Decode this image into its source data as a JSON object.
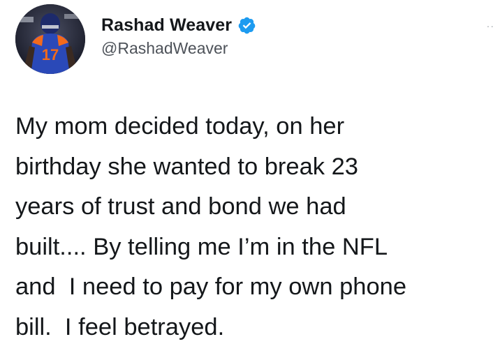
{
  "author": {
    "display_name": "Rashad Weaver",
    "handle": "@RashadWeaver",
    "verified": true,
    "verified_color": "#1d9bf0",
    "avatar_icon": "profile-photo-football-player"
  },
  "menu": {
    "icon": "more-dots-icon",
    "glyph": "··"
  },
  "tweet": {
    "lines": [
      "My mom decided today, on her",
      "birthday she wanted to break 23",
      "years of trust and bond we had",
      "built.... By telling me I’m in the NFL",
      "and  I need to pay for my own phone",
      "bill.  I feel betrayed."
    ]
  }
}
